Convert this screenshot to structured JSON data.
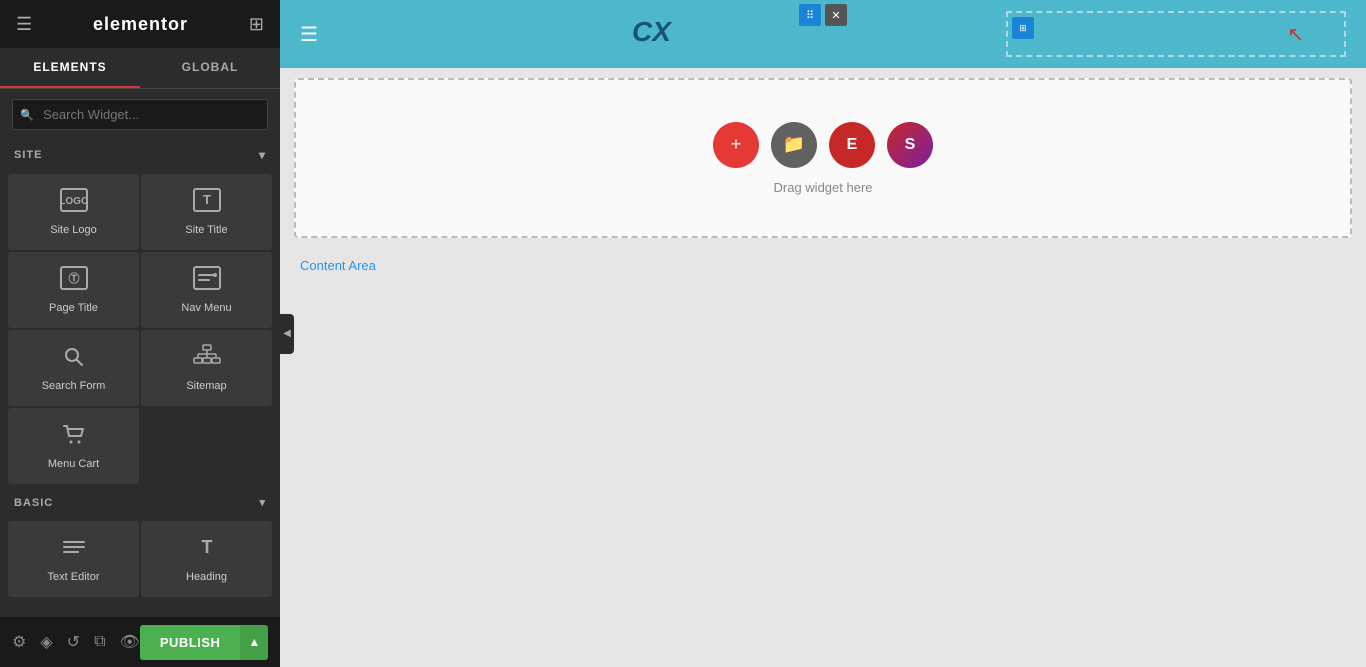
{
  "app": {
    "title": "elementor",
    "menu_icon": "☰",
    "grid_icon": "⊞"
  },
  "panel": {
    "tabs": [
      {
        "label": "ELEMENTS",
        "active": true
      },
      {
        "label": "GLOBAL",
        "active": false
      }
    ],
    "search_placeholder": "Search Widget...",
    "site_section_label": "SITE",
    "basic_section_label": "BASIC",
    "chevron": "▾",
    "widgets": [
      {
        "id": "site-logo",
        "label": "Site Logo",
        "icon": "🖼"
      },
      {
        "id": "site-title",
        "label": "Site Title",
        "icon": "T"
      },
      {
        "id": "page-title",
        "label": "Page Title",
        "icon": "Ⓣ"
      },
      {
        "id": "nav-menu",
        "label": "Nav Menu",
        "icon": "⊟"
      },
      {
        "id": "search-form",
        "label": "Search Form",
        "icon": "🔍"
      },
      {
        "id": "sitemap",
        "label": "Sitemap",
        "icon": "⊕"
      },
      {
        "id": "menu-cart",
        "label": "Menu Cart",
        "icon": "🛒"
      }
    ],
    "basic_widgets": [
      {
        "id": "text-editor",
        "label": "Text Editor",
        "icon": "≡"
      },
      {
        "id": "heading",
        "label": "Heading",
        "icon": "T"
      }
    ]
  },
  "bottom_bar": {
    "publish_label": "PUBLISH",
    "icons": [
      "⚙",
      "◈",
      "↺",
      "⧉",
      "👁"
    ]
  },
  "canvas": {
    "header": {
      "menu_icon": "☰",
      "logo_text": "CX",
      "section_controls": [
        "⠿",
        "✕"
      ],
      "col_ctrl": "⊞"
    },
    "drop_zone": {
      "text": "Drag widget here",
      "circles": [
        {
          "label": "+",
          "color": "red"
        },
        {
          "label": "📁",
          "color": "gray"
        },
        {
          "label": "E",
          "color": "crimson"
        },
        {
          "label": "S",
          "color": "purple"
        }
      ]
    },
    "content_area_label": "Content Area"
  }
}
